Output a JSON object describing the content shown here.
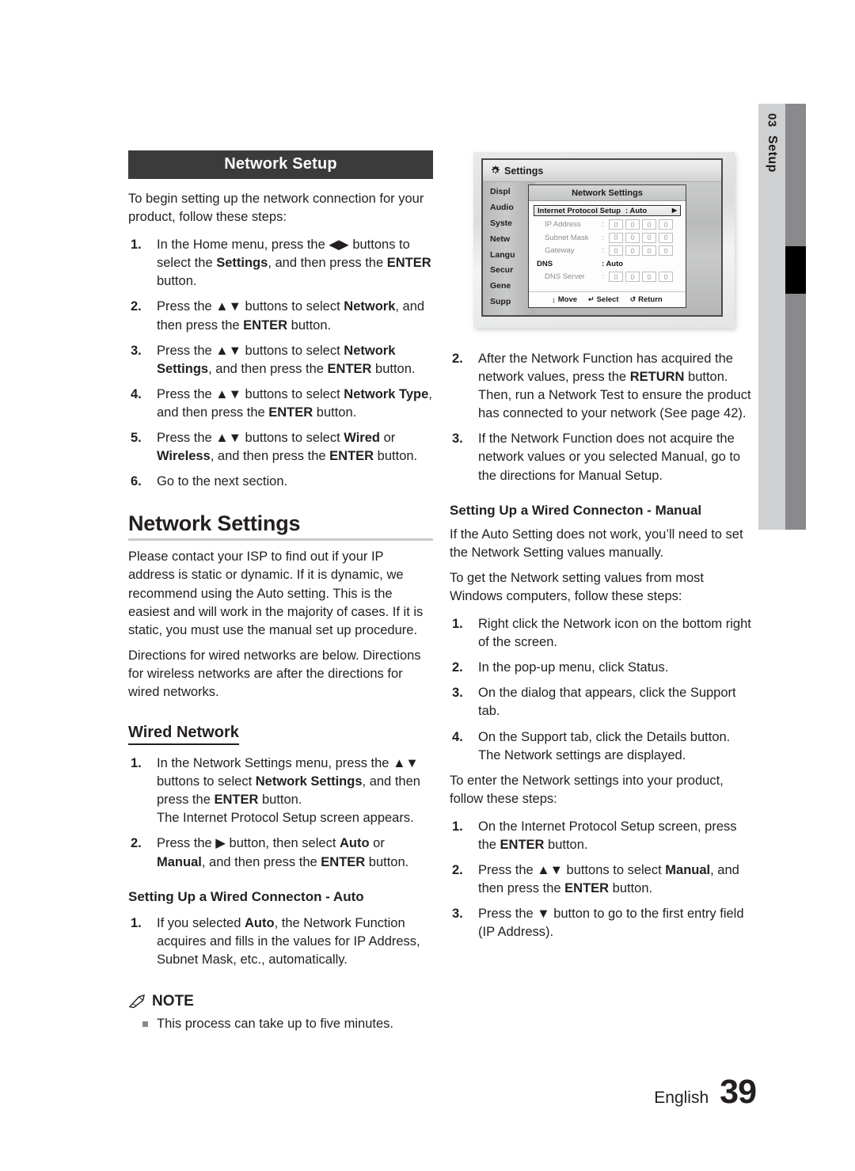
{
  "chapter_tab": {
    "number": "03",
    "name": "Setup"
  },
  "footer": {
    "language": "English",
    "page": "39"
  },
  "left_column": {
    "section_header": "Network Setup",
    "intro": "To begin setting up the network connection for your product, follow these steps:",
    "setup_steps": [
      {
        "num": "1.",
        "html": "In the Home menu, press the ◀▶ buttons to select the <b>Settings</b>, and then press the <b>ENTER</b> button."
      },
      {
        "num": "2.",
        "html": "Press the ▲▼ buttons to select <b>Network</b>, and then press the <b>ENTER</b> button."
      },
      {
        "num": "3.",
        "html": "Press the ▲▼ buttons to select <b>Network Settings</b>, and then press the <b>ENTER</b> button."
      },
      {
        "num": "4.",
        "html": "Press the ▲▼ buttons to select <b>Network Type</b>, and then press the <b>ENTER</b> button."
      },
      {
        "num": "5.",
        "html": "Press the ▲▼ buttons to select <b>Wired</b> or <b>Wireless</b>, and then press the <b>ENTER</b> button."
      },
      {
        "num": "6.",
        "html": "Go to the next section."
      }
    ],
    "network_settings_heading": "Network Settings",
    "network_settings_para1": "Please contact your ISP to find out if your IP address is static or dynamic. If it is dynamic, we recommend using the Auto setting. This is the easiest and will work in the majority of cases. If it is static, you must use the manual set up procedure.",
    "network_settings_para2": "Directions for wired networks are below. Directions for wireless networks are after the directions for wired networks.",
    "wired_network_heading": "Wired Network",
    "wired_steps": [
      {
        "num": "1.",
        "html": "In the Network Settings menu, press the ▲▼ buttons to select <b>Network Settings</b>, and then press the <b>ENTER</b> button.<br>The Internet Protocol Setup screen appears."
      },
      {
        "num": "2.",
        "html": "Press the ▶ button, then select <b>Auto</b> or <b>Manual</b>, and then press the <b>ENTER</b> button."
      }
    ],
    "auto_heading": "Setting Up a Wired Connecton - Auto",
    "auto_steps": [
      {
        "num": "1.",
        "html": "If you selected <b>Auto</b>, the Network Function acquires and fills in the values for IP Address, Subnet Mask, etc., automatically."
      }
    ],
    "note": {
      "label": "NOTE",
      "items": [
        "This process can take up to five minutes."
      ]
    }
  },
  "right_column": {
    "auto_steps_continued": [
      {
        "num": "2.",
        "html": "After the Network Function has acquired the network values, press the <b>RETURN</b> button. Then, run a Network Test to ensure the product has connected to your network (See page 42)."
      },
      {
        "num": "3.",
        "html": "If the Network Function does not acquire the network values or you selected Manual, go to the directions for Manual Setup."
      }
    ],
    "manual_heading": "Setting Up a Wired Connecton - Manual",
    "manual_para1": "If the Auto Setting does not work, you’ll need to set the Network Setting values manually.",
    "manual_para2": "To get the Network setting values from most Windows computers, follow these steps:",
    "windows_steps": [
      {
        "num": "1.",
        "html": "Right click the Network icon on the bottom right of the screen."
      },
      {
        "num": "2.",
        "html": "In the pop-up menu, click Status."
      },
      {
        "num": "3.",
        "html": "On the dialog that appears, click the Support tab."
      },
      {
        "num": "4.",
        "html": "On the Support tab, click the Details button.<br>The Network settings are displayed."
      }
    ],
    "enter_para": "To enter the Network settings into your product, follow these steps:",
    "enter_steps": [
      {
        "num": "1.",
        "html": "On the Internet Protocol Setup screen, press the <b>ENTER</b> button."
      },
      {
        "num": "2.",
        "html": "Press the ▲▼ buttons to select <b>Manual</b>, and then press the <b>ENTER</b> button."
      },
      {
        "num": "3.",
        "html": "Press the ▼ button to go to the first entry field (IP Address)."
      }
    ]
  },
  "tv_screenshot": {
    "header_title": "Settings",
    "sidebar_items": [
      "Displ",
      "Audio",
      "Syste",
      "Netw",
      "Langu",
      "Secur",
      "Gene",
      "Supp"
    ],
    "dialog_title": "Network Settings",
    "ip_setup": {
      "label": "Internet Protocol Setup",
      "value": ": Auto",
      "arrow": "▶"
    },
    "fields": [
      {
        "label": "IP Address",
        "colon": ":",
        "octets": [
          "0",
          "0",
          "0",
          "0"
        ]
      },
      {
        "label": "Subnet Mask",
        "colon": ":",
        "octets": [
          "0",
          "0",
          "0",
          "0"
        ]
      },
      {
        "label": "Gateway",
        "colon": ":",
        "octets": [
          "0",
          "0",
          "0",
          "0"
        ]
      }
    ],
    "dns": {
      "label": "DNS",
      "value": ": Auto"
    },
    "dns_server": {
      "label": "DNS Server",
      "colon": ":",
      "octets": [
        "0",
        "0",
        "0",
        "0"
      ]
    },
    "hints": [
      {
        "glyph": "↕",
        "text": "Move"
      },
      {
        "glyph": "↵",
        "text": "Select"
      },
      {
        "glyph": "↺",
        "text": "Return"
      }
    ]
  }
}
